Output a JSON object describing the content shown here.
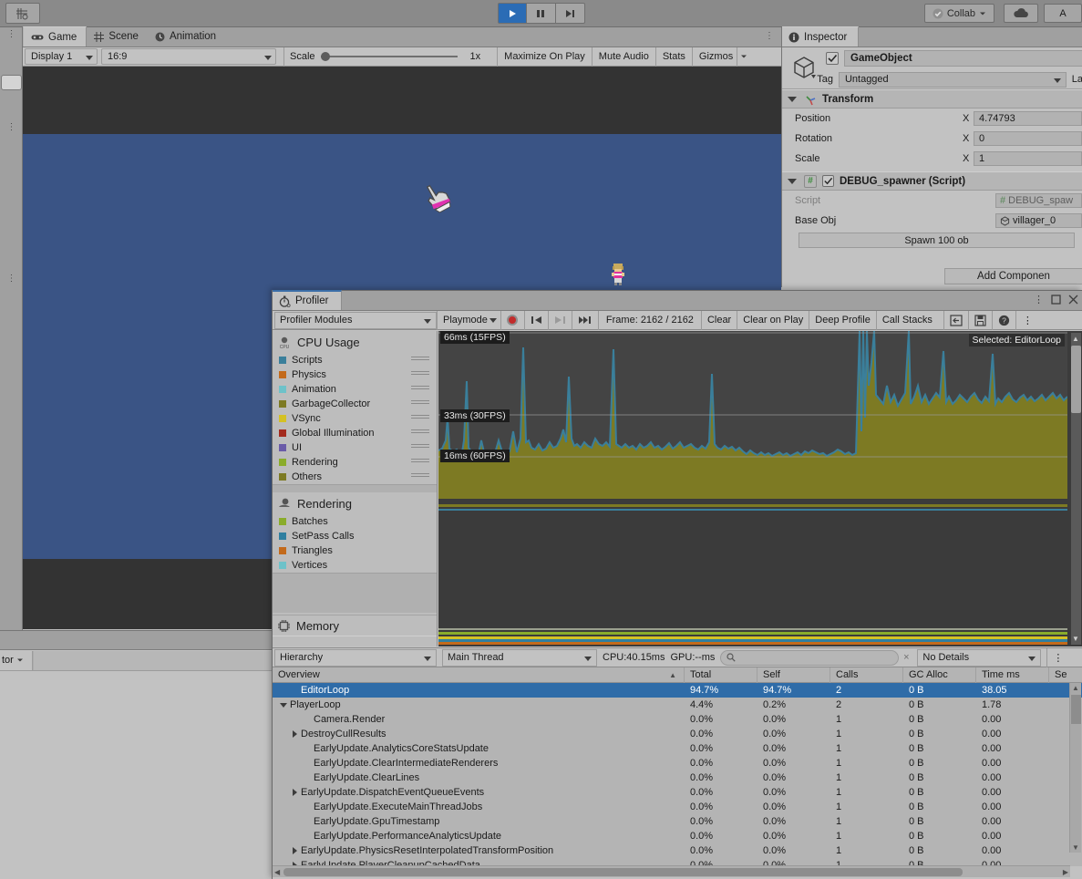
{
  "toolbar": {
    "play_icon": "play-icon",
    "pause_icon": "pause-icon",
    "step_icon": "step-icon",
    "collab_label": "Collab",
    "cloud_icon": "cloud-icon",
    "account_label": "A",
    "left_tool_icon": "transform-pivot-icon"
  },
  "game_panel": {
    "tabs": [
      {
        "label": "Game",
        "icon": "gamepad-icon",
        "active": true
      },
      {
        "label": "Scene",
        "icon": "grid-icon",
        "active": false
      },
      {
        "label": "Animation",
        "icon": "clock-icon",
        "active": false
      }
    ],
    "display_select": "Display 1",
    "aspect_select": "16:9",
    "scale_label": "Scale",
    "scale_value": "1x",
    "buttons": [
      "Maximize On Play",
      "Mute Audio",
      "Stats",
      "Gizmos"
    ],
    "water_color": "#3a5485",
    "bg_color": "#333333"
  },
  "inspector": {
    "tab_label": "Inspector",
    "object_name": "GameObject",
    "object_enabled": true,
    "tag_label": "Tag",
    "tag_value": "Untagged",
    "layer_label": "La",
    "components": [
      {
        "name": "Transform",
        "icon": "transform-axis-icon",
        "rows": [
          {
            "label": "Position",
            "axis": "X",
            "value": "4.74793"
          },
          {
            "label": "Rotation",
            "axis": "X",
            "value": "0"
          },
          {
            "label": "Scale",
            "axis": "X",
            "value": "1"
          }
        ]
      },
      {
        "name": "DEBUG_spawner (Script)",
        "icon": "csharp-script-icon",
        "enabled": true,
        "script_label": "Script",
        "script_value": "DEBUG_spaw",
        "baseobj_label": "Base Obj",
        "baseobj_value": "villager_0",
        "spawn_button": "Spawn 100 ob"
      }
    ],
    "add_component": "Add Componen"
  },
  "lower_left": {
    "selector_value": "tor"
  },
  "profiler": {
    "tab_label": "Profiler",
    "tab_icon": "stopwatch-icon",
    "modules_dropdown": "Profiler Modules",
    "playmode_dropdown": "Playmode",
    "record_icon": "record-icon",
    "nav_first_icon": "prev-frame-icon",
    "nav_next_icon": "next-frame-icon",
    "nav_last_icon": "last-frame-icon",
    "frame_label": "Frame: 2162 / 2162",
    "buttons": [
      "Clear",
      "Clear on Play",
      "Deep Profile",
      "Call Stacks"
    ],
    "right_icons": [
      "load-icon",
      "save-icon",
      "help-icon",
      "kebab-icon"
    ],
    "window_icons": [
      "kebab-icon",
      "maximize-icon",
      "close-icon"
    ],
    "modules": [
      {
        "title": "CPU Usage",
        "icon": "cpu-icon",
        "items": [
          {
            "label": "Scripts",
            "color": "#3a7f9b"
          },
          {
            "label": "Physics",
            "color": "#c36a1b"
          },
          {
            "label": "Animation",
            "color": "#6ec2c9"
          },
          {
            "label": "GarbageCollector",
            "color": "#7d7a23"
          },
          {
            "label": "VSync",
            "color": "#d4c124"
          },
          {
            "label": "Global Illumination",
            "color": "#a32b1e"
          },
          {
            "label": "UI",
            "color": "#6a5ba8"
          },
          {
            "label": "Rendering",
            "color": "#8aac2b"
          },
          {
            "label": "Others",
            "color": "#7d7a23"
          }
        ]
      },
      {
        "title": "Rendering",
        "icon": "rendering-icon",
        "items": [
          {
            "label": "Batches",
            "color": "#8aac2b"
          },
          {
            "label": "SetPass Calls",
            "color": "#2f7fa0"
          },
          {
            "label": "Triangles",
            "color": "#c36a1b"
          },
          {
            "label": "Vertices",
            "color": "#6ec2c9"
          }
        ]
      },
      {
        "title": "Memory",
        "icon": "memory-icon",
        "items": []
      }
    ],
    "graph": {
      "gridlines": [
        {
          "label": "66ms (15FPS)",
          "y": 0
        },
        {
          "label": "33ms (30FPS)",
          "y": 86
        },
        {
          "label": "16ms (60FPS)",
          "y": 130
        }
      ],
      "selected_label": "Selected: EditorLoop",
      "bg_color": "#444444",
      "series_color": "#7d7a23",
      "accent_color": "#3a7f9b"
    },
    "hierarchy_bar": {
      "view_mode": "Hierarchy",
      "thread": "Main Thread",
      "cpu_stat": "CPU:40.15ms",
      "gpu_stat": "GPU:--ms",
      "search_placeholder": "",
      "search_icon": "search-icon",
      "details_mode": "No Details",
      "kebab_icon": "kebab-icon"
    },
    "table": {
      "columns": [
        "Overview",
        "Total",
        "Self",
        "Calls",
        "GC Alloc",
        "Time ms",
        "Se"
      ],
      "rows": [
        {
          "name": "EditorLoop",
          "indent": 1,
          "arrow": "none",
          "total": "94.7%",
          "self": "94.7%",
          "calls": "2",
          "gc": "0 B",
          "time": "38.05",
          "selected": true
        },
        {
          "name": "PlayerLoop",
          "indent": 0,
          "arrow": "down",
          "total": "4.4%",
          "self": "0.2%",
          "calls": "2",
          "gc": "0 B",
          "time": "1.78",
          "selected": false
        },
        {
          "name": "Camera.Render",
          "indent": 2,
          "arrow": "none",
          "total": "0.0%",
          "self": "0.0%",
          "calls": "1",
          "gc": "0 B",
          "time": "0.00",
          "selected": false
        },
        {
          "name": "DestroyCullResults",
          "indent": 1,
          "arrow": "right",
          "total": "0.0%",
          "self": "0.0%",
          "calls": "1",
          "gc": "0 B",
          "time": "0.00",
          "selected": false
        },
        {
          "name": "EarlyUpdate.AnalyticsCoreStatsUpdate",
          "indent": 2,
          "arrow": "none",
          "total": "0.0%",
          "self": "0.0%",
          "calls": "1",
          "gc": "0 B",
          "time": "0.00",
          "selected": false
        },
        {
          "name": "EarlyUpdate.ClearIntermediateRenderers",
          "indent": 2,
          "arrow": "none",
          "total": "0.0%",
          "self": "0.0%",
          "calls": "1",
          "gc": "0 B",
          "time": "0.00",
          "selected": false
        },
        {
          "name": "EarlyUpdate.ClearLines",
          "indent": 2,
          "arrow": "none",
          "total": "0.0%",
          "self": "0.0%",
          "calls": "1",
          "gc": "0 B",
          "time": "0.00",
          "selected": false
        },
        {
          "name": "EarlyUpdate.DispatchEventQueueEvents",
          "indent": 1,
          "arrow": "right",
          "total": "0.0%",
          "self": "0.0%",
          "calls": "1",
          "gc": "0 B",
          "time": "0.00",
          "selected": false
        },
        {
          "name": "EarlyUpdate.ExecuteMainThreadJobs",
          "indent": 2,
          "arrow": "none",
          "total": "0.0%",
          "self": "0.0%",
          "calls": "1",
          "gc": "0 B",
          "time": "0.00",
          "selected": false
        },
        {
          "name": "EarlyUpdate.GpuTimestamp",
          "indent": 2,
          "arrow": "none",
          "total": "0.0%",
          "self": "0.0%",
          "calls": "1",
          "gc": "0 B",
          "time": "0.00",
          "selected": false
        },
        {
          "name": "EarlyUpdate.PerformanceAnalyticsUpdate",
          "indent": 2,
          "arrow": "none",
          "total": "0.0%",
          "self": "0.0%",
          "calls": "1",
          "gc": "0 B",
          "time": "0.00",
          "selected": false
        },
        {
          "name": "EarlyUpdate.PhysicsResetInterpolatedTransformPosition",
          "indent": 1,
          "arrow": "right",
          "total": "0.0%",
          "self": "0.0%",
          "calls": "1",
          "gc": "0 B",
          "time": "0.00",
          "selected": false
        },
        {
          "name": "EarlyUpdate.PlayerCleanupCachedData",
          "indent": 1,
          "arrow": "right",
          "total": "0.0%",
          "self": "0.0%",
          "calls": "1",
          "gc": "0 B",
          "time": "0.00",
          "selected": false
        }
      ]
    }
  },
  "chart_data": {
    "type": "area",
    "title": "CPU Usage",
    "ylabel": "ms",
    "gridlines_ms": [
      66,
      33,
      16
    ],
    "gridline_labels": [
      "66ms (15FPS)",
      "33ms (30FPS)",
      "16ms (60FPS)"
    ],
    "series": [
      {
        "name": "EditorLoop (Others)",
        "color": "#7d7a23"
      },
      {
        "name": "Scripts",
        "color": "#3a7f9b"
      }
    ],
    "annotation": "Selected: EditorLoop",
    "frame_range": "2162 / 2162"
  }
}
